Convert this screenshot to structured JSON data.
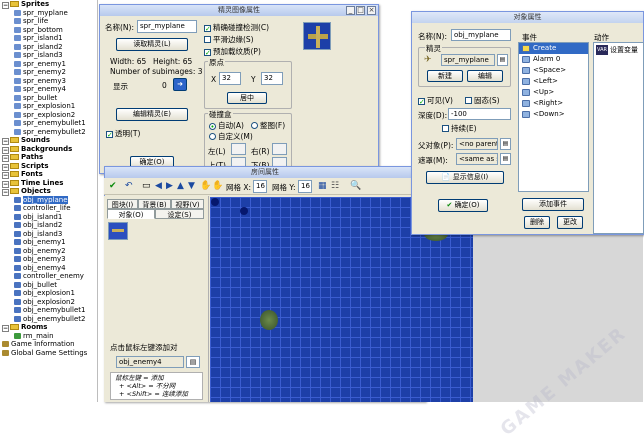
{
  "resource_tree": [
    {
      "label": "Sprites",
      "type": "folder",
      "depth": 0
    },
    {
      "label": "spr_myplane",
      "type": "sprite",
      "depth": 1
    },
    {
      "label": "spr_life",
      "type": "sprite",
      "depth": 1
    },
    {
      "label": "spr_bottom",
      "type": "sprite",
      "depth": 1
    },
    {
      "label": "spr_island1",
      "type": "sprite",
      "depth": 1
    },
    {
      "label": "spr_island2",
      "type": "sprite",
      "depth": 1
    },
    {
      "label": "spr_island3",
      "type": "sprite",
      "depth": 1
    },
    {
      "label": "spr_enemy1",
      "type": "sprite",
      "depth": 1
    },
    {
      "label": "spr_enemy2",
      "type": "sprite",
      "depth": 1
    },
    {
      "label": "spr_enemy3",
      "type": "sprite",
      "depth": 1
    },
    {
      "label": "spr_enemy4",
      "type": "sprite",
      "depth": 1
    },
    {
      "label": "spr_bullet",
      "type": "sprite",
      "depth": 1
    },
    {
      "label": "spr_explosion1",
      "type": "sprite",
      "depth": 1
    },
    {
      "label": "spr_explosion2",
      "type": "sprite",
      "depth": 1
    },
    {
      "label": "spr_enemybullet1",
      "type": "sprite",
      "depth": 1
    },
    {
      "label": "spr_enemybullet2",
      "type": "sprite",
      "depth": 1
    },
    {
      "label": "Sounds",
      "type": "folder",
      "depth": 0
    },
    {
      "label": "Backgrounds",
      "type": "folder",
      "depth": 0
    },
    {
      "label": "Paths",
      "type": "folder",
      "depth": 0
    },
    {
      "label": "Scripts",
      "type": "folder",
      "depth": 0
    },
    {
      "label": "Fonts",
      "type": "folder",
      "depth": 0
    },
    {
      "label": "Time Lines",
      "type": "folder",
      "depth": 0
    },
    {
      "label": "Objects",
      "type": "folder",
      "depth": 0
    },
    {
      "label": "obj_myplane",
      "type": "object",
      "depth": 1,
      "selected": true
    },
    {
      "label": "controller_life",
      "type": "object",
      "depth": 1
    },
    {
      "label": "obj_island1",
      "type": "object",
      "depth": 1
    },
    {
      "label": "obj_island2",
      "type": "object",
      "depth": 1
    },
    {
      "label": "obj_island3",
      "type": "object",
      "depth": 1
    },
    {
      "label": "obj_enemy1",
      "type": "object",
      "depth": 1
    },
    {
      "label": "obj_enemy2",
      "type": "object",
      "depth": 1
    },
    {
      "label": "obj_enemy3",
      "type": "object",
      "depth": 1
    },
    {
      "label": "obj_enemy4",
      "type": "object",
      "depth": 1
    },
    {
      "label": "controller_enemy",
      "type": "object",
      "depth": 1
    },
    {
      "label": "obj_bullet",
      "type": "object",
      "depth": 1
    },
    {
      "label": "obj_explosion1",
      "type": "object",
      "depth": 1
    },
    {
      "label": "obj_explosion2",
      "type": "object",
      "depth": 1
    },
    {
      "label": "obj_enemybullet1",
      "type": "object",
      "depth": 1
    },
    {
      "label": "obj_enemybullet2",
      "type": "object",
      "depth": 1
    },
    {
      "label": "Rooms",
      "type": "folder",
      "depth": 0
    },
    {
      "label": "rm_main",
      "type": "room",
      "depth": 1
    },
    {
      "label": "Game Information",
      "type": "info",
      "depth": 0
    },
    {
      "label": "Global Game Settings",
      "type": "info",
      "depth": 0
    }
  ],
  "sprite_window": {
    "title": "精灵图像属性",
    "name_label": "名称(N):",
    "name_value": "spr_myplane",
    "load_button": "读取精灵(L)",
    "width_text": "Width: 65",
    "height_text": "Height: 65",
    "subimages_text": "Number of subimages: 3",
    "show_label": "显示",
    "show_value": "0",
    "edit_button": "编辑精灵(E)",
    "transparent_label": "透明(T)",
    "ok_button": "确定(O)",
    "precise_label": "精确碰撞检测(C)",
    "smooth_label": "平滑边缘(S)",
    "preload_label": "预加载纹质(P)",
    "origin_group": "原点",
    "origin_x_label": "X",
    "origin_x": "32",
    "origin_y_label": "Y",
    "origin_y": "32",
    "center_button": "居中",
    "bbox_group": "碰撞盒",
    "bbox_auto": "自动(A)",
    "bbox_full": "整图(F)",
    "bbox_manual": "自定义(M)",
    "left_label": "左(L)",
    "right_label": "右(R)",
    "top_label": "上(T)",
    "bottom_label": "下(B)"
  },
  "room_window": {
    "title": "房间属性",
    "grid_x_label": "网格 X:",
    "grid_x": "16",
    "grid_y_label": "网格 Y:",
    "grid_y": "16",
    "tabs_row1": [
      "图块(I)",
      "背景(B)",
      "视野(V)"
    ],
    "tabs_row2": [
      "对象(O)",
      "设定(S)"
    ],
    "hint": "点击鼠标左键添加对",
    "selected_object": "obj_enemy4",
    "help_line1": "鼠标左键 = 添加",
    "help_line2": "+ <Alt> = 不分网",
    "help_line3": "+ <Shift> = 连续添加"
  },
  "object_window": {
    "title": "对象属性",
    "name_label": "名称(N):",
    "name_value": "obj_myplane",
    "sprite_group": "精灵",
    "sprite_value": "spr_myplane",
    "new_button": "新建",
    "edit_button": "编辑",
    "visible_label": "可见(V)",
    "solid_label": "固态(S)",
    "depth_label": "深度(D):",
    "depth_value": "-100",
    "persistent_label": "持续(E)",
    "parent_label": "父对象(P):",
    "parent_value": "<no parent>",
    "mask_label": "遮罩(M):",
    "mask_value": "<same as spri",
    "info_button": "显示信息(I)",
    "ok_button": "确定(O)",
    "events_header": "事件",
    "actions_header": "动作",
    "events": [
      "Create",
      "Alarm 0",
      "<Space>",
      "<Left>",
      "<Up>",
      "<Right>",
      "<Down>"
    ],
    "action_item": "设置变量",
    "add_event_button": "添加事件",
    "delete_button": "删除",
    "change_button": "更改"
  },
  "watermark": "GAME MAKER",
  "colors": {
    "room_background": "#1d3fa8",
    "grid_line": "#3b5dd0",
    "selection": "#316ac5",
    "title_gradient_top": "#d8e4f8"
  }
}
